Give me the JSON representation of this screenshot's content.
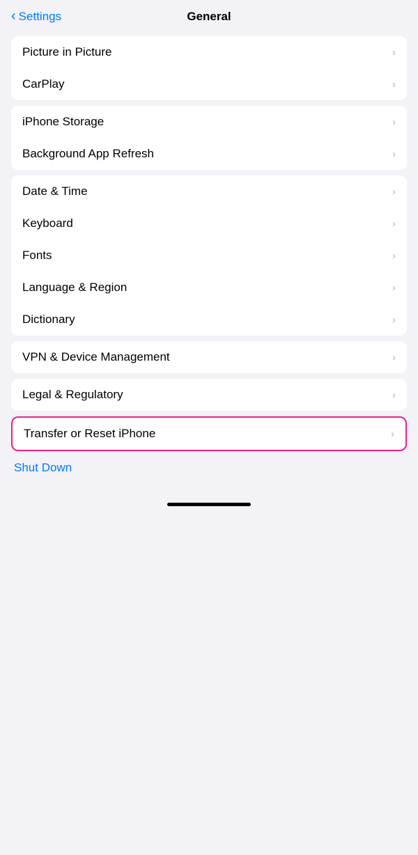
{
  "header": {
    "back_label": "Settings",
    "title": "General"
  },
  "sections": [
    {
      "id": "section1",
      "items": [
        {
          "label": "Picture in Picture"
        },
        {
          "label": "CarPlay"
        }
      ]
    },
    {
      "id": "section2",
      "items": [
        {
          "label": "iPhone Storage"
        },
        {
          "label": "Background App Refresh"
        }
      ]
    },
    {
      "id": "section3",
      "items": [
        {
          "label": "Date & Time"
        },
        {
          "label": "Keyboard"
        },
        {
          "label": "Fonts"
        },
        {
          "label": "Language & Region"
        },
        {
          "label": "Dictionary"
        }
      ]
    },
    {
      "id": "section4",
      "items": [
        {
          "label": "VPN & Device Management"
        }
      ]
    },
    {
      "id": "section5",
      "items": [
        {
          "label": "Legal & Regulatory"
        }
      ]
    }
  ],
  "highlighted_item": {
    "label": "Transfer or Reset iPhone"
  },
  "shut_down": {
    "label": "Shut Down"
  },
  "icons": {
    "chevron_left": "‹",
    "chevron_right": "›"
  }
}
